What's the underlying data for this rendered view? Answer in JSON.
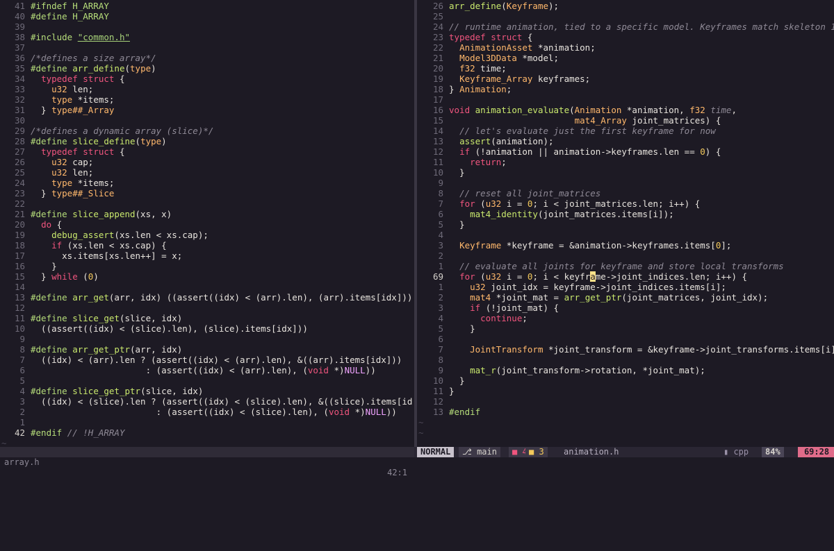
{
  "left": {
    "filename": "array.h",
    "position": "42:1",
    "lines": [
      {
        "n": "41",
        "h": [
          [
            "pp",
            "#ifndef H_ARRAY"
          ]
        ]
      },
      {
        "n": "40",
        "h": [
          [
            "pp",
            "#define H_ARRAY"
          ]
        ]
      },
      {
        "n": "39",
        "h": []
      },
      {
        "n": "38",
        "h": [
          [
            "pp",
            "#include "
          ],
          [
            "str",
            "\"common.h\""
          ]
        ]
      },
      {
        "n": "37",
        "h": []
      },
      {
        "n": "36",
        "h": [
          [
            "cm",
            "/*defines a size array*/"
          ]
        ]
      },
      {
        "n": "35",
        "h": [
          [
            "pp",
            "#define "
          ],
          [
            "fn",
            "arr_define"
          ],
          [
            "id",
            "("
          ],
          [
            "ty",
            "type"
          ],
          [
            "id",
            ")"
          ]
        ]
      },
      {
        "n": "34",
        "h": [
          [
            "id",
            "  "
          ],
          [
            "kw",
            "typedef struct "
          ],
          [
            "id",
            "{"
          ]
        ]
      },
      {
        "n": "33",
        "h": [
          [
            "id",
            "    "
          ],
          [
            "ty",
            "u32 "
          ],
          [
            "id",
            "len;"
          ]
        ]
      },
      {
        "n": "32",
        "h": [
          [
            "id",
            "    "
          ],
          [
            "ty",
            "type "
          ],
          [
            "id",
            "*items;"
          ]
        ]
      },
      {
        "n": "31",
        "h": [
          [
            "id",
            "  } "
          ],
          [
            "ty",
            "type##_Array"
          ]
        ]
      },
      {
        "n": "30",
        "h": []
      },
      {
        "n": "29",
        "h": [
          [
            "cm",
            "/*defines a dynamic array (slice)*/"
          ]
        ]
      },
      {
        "n": "28",
        "h": [
          [
            "pp",
            "#define "
          ],
          [
            "fn",
            "slice_define"
          ],
          [
            "id",
            "("
          ],
          [
            "ty",
            "type"
          ],
          [
            "id",
            ")"
          ]
        ]
      },
      {
        "n": "27",
        "h": [
          [
            "id",
            "  "
          ],
          [
            "kw",
            "typedef struct "
          ],
          [
            "id",
            "{"
          ]
        ]
      },
      {
        "n": "26",
        "h": [
          [
            "id",
            "    "
          ],
          [
            "ty",
            "u32 "
          ],
          [
            "id",
            "cap;"
          ]
        ]
      },
      {
        "n": "25",
        "h": [
          [
            "id",
            "    "
          ],
          [
            "ty",
            "u32 "
          ],
          [
            "id",
            "len;"
          ]
        ]
      },
      {
        "n": "24",
        "h": [
          [
            "id",
            "    "
          ],
          [
            "ty",
            "type "
          ],
          [
            "id",
            "*items;"
          ]
        ]
      },
      {
        "n": "23",
        "h": [
          [
            "id",
            "  } "
          ],
          [
            "ty",
            "type##_Slice"
          ]
        ]
      },
      {
        "n": "22",
        "h": []
      },
      {
        "n": "21",
        "h": [
          [
            "pp",
            "#define "
          ],
          [
            "fn",
            "slice_append"
          ],
          [
            "id",
            "(xs, x)"
          ]
        ]
      },
      {
        "n": "20",
        "h": [
          [
            "id",
            "  "
          ],
          [
            "kw",
            "do "
          ],
          [
            "id",
            "{"
          ]
        ]
      },
      {
        "n": "19",
        "h": [
          [
            "id",
            "    "
          ],
          [
            "fn",
            "debug_assert"
          ],
          [
            "id",
            "(xs.len < xs.cap);"
          ]
        ]
      },
      {
        "n": "18",
        "h": [
          [
            "id",
            "    "
          ],
          [
            "kw",
            "if "
          ],
          [
            "id",
            "(xs.len < xs.cap) {"
          ]
        ]
      },
      {
        "n": "17",
        "h": [
          [
            "id",
            "      xs.items[xs.len++] = x;"
          ]
        ]
      },
      {
        "n": "16",
        "h": [
          [
            "id",
            "    }"
          ]
        ]
      },
      {
        "n": "15",
        "h": [
          [
            "id",
            "  } "
          ],
          [
            "kw",
            "while "
          ],
          [
            "id",
            "("
          ],
          [
            "num",
            "0"
          ],
          [
            "id",
            ")"
          ]
        ]
      },
      {
        "n": "14",
        "h": []
      },
      {
        "n": "13",
        "h": [
          [
            "pp",
            "#define "
          ],
          [
            "fn",
            "arr_get"
          ],
          [
            "id",
            "(arr, idx) ((assert((idx) < (arr).len), (arr).items[idx]))"
          ]
        ]
      },
      {
        "n": "12",
        "h": []
      },
      {
        "n": "11",
        "h": [
          [
            "pp",
            "#define "
          ],
          [
            "fn",
            "slice_get"
          ],
          [
            "id",
            "(slice, idx)"
          ]
        ]
      },
      {
        "n": "10",
        "h": [
          [
            "id",
            "  ((assert((idx) < (slice).len), (slice).items[idx]))"
          ]
        ]
      },
      {
        "n": "9",
        "h": []
      },
      {
        "n": "8",
        "h": [
          [
            "pp",
            "#define "
          ],
          [
            "fn",
            "arr_get_ptr"
          ],
          [
            "id",
            "(arr, idx)"
          ]
        ]
      },
      {
        "n": "7",
        "h": [
          [
            "id",
            "  ((idx) < (arr).len ? (assert((idx) < (arr).len), &((arr).items[idx]))"
          ]
        ]
      },
      {
        "n": "6",
        "h": [
          [
            "id",
            "                      : (assert((idx) < (arr).len), ("
          ],
          [
            "kw",
            "void "
          ],
          [
            "id",
            "*)"
          ],
          [
            "mac",
            "NULL"
          ],
          [
            "id",
            "))"
          ]
        ]
      },
      {
        "n": "5",
        "h": []
      },
      {
        "n": "4",
        "h": [
          [
            "pp",
            "#define "
          ],
          [
            "fn",
            "slice_get_ptr"
          ],
          [
            "id",
            "(slice, idx)"
          ]
        ]
      },
      {
        "n": "3",
        "h": [
          [
            "id",
            "  ((idx) < (slice).len ? (assert((idx) < (slice).len), &((slice).items[id"
          ]
        ]
      },
      {
        "n": "2",
        "h": [
          [
            "id",
            "                        : (assert((idx) < (slice).len), ("
          ],
          [
            "kw",
            "void "
          ],
          [
            "id",
            "*)"
          ],
          [
            "mac",
            "NULL"
          ],
          [
            "id",
            "))"
          ]
        ]
      },
      {
        "n": "1",
        "h": []
      },
      {
        "n": "42",
        "cur": true,
        "h": [
          [
            "pp",
            "#endif "
          ],
          [
            "cm",
            "// !H_ARRAY"
          ]
        ]
      }
    ],
    "tildes": 1
  },
  "right": {
    "filename": "animation.h",
    "position": "69:28",
    "percent": "84%",
    "filetype": "cpp",
    "mode": "NORMAL",
    "branch": "main",
    "branch_icon": "git-branch-icon",
    "errors": "4",
    "warnings": "3",
    "lines": [
      {
        "n": "26",
        "h": [
          [
            "fn",
            "arr_define"
          ],
          [
            "id",
            "("
          ],
          [
            "ty",
            "Keyframe"
          ],
          [
            "id",
            ");"
          ]
        ]
      },
      {
        "n": "25",
        "h": []
      },
      {
        "n": "24",
        "h": [
          [
            "cm",
            "// runtime animation, tied to a specific model. Keyframes match skeleton 1"
          ]
        ]
      },
      {
        "n": "23",
        "h": [
          [
            "kw",
            "typedef struct "
          ],
          [
            "id",
            "{"
          ]
        ]
      },
      {
        "n": "22",
        "h": [
          [
            "id",
            "  "
          ],
          [
            "ty",
            "AnimationAsset "
          ],
          [
            "id",
            "*animation;"
          ]
        ]
      },
      {
        "n": "21",
        "h": [
          [
            "id",
            "  "
          ],
          [
            "ty",
            "Model3DData "
          ],
          [
            "id",
            "*model;"
          ]
        ]
      },
      {
        "n": "20",
        "h": [
          [
            "id",
            "  "
          ],
          [
            "ty",
            "f32 "
          ],
          [
            "id",
            "time;"
          ]
        ]
      },
      {
        "n": "19",
        "h": [
          [
            "id",
            "  "
          ],
          [
            "ty",
            "Keyframe_Array "
          ],
          [
            "id",
            "keyframes;"
          ]
        ]
      },
      {
        "n": "18",
        "h": [
          [
            "id",
            "} "
          ],
          [
            "ty",
            "Animation"
          ],
          [
            "id",
            ";"
          ]
        ]
      },
      {
        "n": "17",
        "h": []
      },
      {
        "n": "16",
        "h": [
          [
            "kw",
            "void "
          ],
          [
            "fn",
            "animation_evaluate"
          ],
          [
            "id",
            "("
          ],
          [
            "ty",
            "Animation "
          ],
          [
            "id",
            "*animation, "
          ],
          [
            "ty",
            "f32 "
          ],
          [
            "cm",
            "time"
          ],
          [
            "id",
            ","
          ]
        ]
      },
      {
        "n": "15",
        "h": [
          [
            "id",
            "                        "
          ],
          [
            "ty",
            "mat4_Array "
          ],
          [
            "id",
            "joint_matrices) {"
          ]
        ]
      },
      {
        "n": "14",
        "h": [
          [
            "id",
            "  "
          ],
          [
            "cm",
            "// let's evaluate just the first keyframe for now"
          ]
        ]
      },
      {
        "n": "13",
        "h": [
          [
            "id",
            "  "
          ],
          [
            "fn",
            "assert"
          ],
          [
            "id",
            "(animation);"
          ]
        ]
      },
      {
        "n": "12",
        "h": [
          [
            "id",
            "  "
          ],
          [
            "kw",
            "if "
          ],
          [
            "id",
            "(!animation || animation->keyframes.len == "
          ],
          [
            "num",
            "0"
          ],
          [
            "id",
            ") {"
          ]
        ]
      },
      {
        "n": "11",
        "h": [
          [
            "id",
            "    "
          ],
          [
            "kw",
            "return"
          ],
          [
            "id",
            ";"
          ]
        ]
      },
      {
        "n": "10",
        "h": [
          [
            "id",
            "  }"
          ]
        ]
      },
      {
        "n": "9",
        "h": []
      },
      {
        "n": "8",
        "h": [
          [
            "id",
            "  "
          ],
          [
            "cm",
            "// reset all joint_matrices"
          ]
        ]
      },
      {
        "n": "7",
        "h": [
          [
            "id",
            "  "
          ],
          [
            "kw",
            "for "
          ],
          [
            "id",
            "("
          ],
          [
            "ty",
            "u32 "
          ],
          [
            "id",
            "i = "
          ],
          [
            "num",
            "0"
          ],
          [
            "id",
            "; i < joint_matrices.len; i++) {"
          ]
        ]
      },
      {
        "n": "6",
        "h": [
          [
            "id",
            "    "
          ],
          [
            "fn",
            "mat4_identity"
          ],
          [
            "id",
            "(joint_matrices.items[i]);"
          ]
        ]
      },
      {
        "n": "5",
        "h": [
          [
            "id",
            "  }"
          ]
        ]
      },
      {
        "n": "4",
        "h": []
      },
      {
        "n": "3",
        "h": [
          [
            "id",
            "  "
          ],
          [
            "ty",
            "Keyframe "
          ],
          [
            "id",
            "*keyframe = &animation->keyframes.items["
          ],
          [
            "num",
            "0"
          ],
          [
            "id",
            "];"
          ]
        ]
      },
      {
        "n": "2",
        "h": []
      },
      {
        "n": "1",
        "h": [
          [
            "id",
            "  "
          ],
          [
            "cm",
            "// evaluate all joints for keyframe and store local transforms"
          ]
        ]
      },
      {
        "n": "69",
        "cur": true,
        "h": [
          [
            "id",
            "  "
          ],
          [
            "kw",
            "for "
          ],
          [
            "id",
            "("
          ],
          [
            "ty",
            "u32 "
          ],
          [
            "id",
            "i = "
          ],
          [
            "num",
            "0"
          ],
          [
            "id",
            "; i < keyfr"
          ],
          [
            "cursor",
            "a"
          ],
          [
            "id",
            "me->joint_indices.len; i++) {"
          ]
        ]
      },
      {
        "n": "1",
        "h": [
          [
            "id",
            "    "
          ],
          [
            "ty",
            "u32 "
          ],
          [
            "id",
            "joint_idx = keyframe->joint_indices.items[i];"
          ]
        ]
      },
      {
        "n": "2",
        "h": [
          [
            "id",
            "    "
          ],
          [
            "ty",
            "mat4 "
          ],
          [
            "id",
            "*joint_mat = "
          ],
          [
            "fn",
            "arr_get_ptr"
          ],
          [
            "id",
            "(joint_matrices, joint_idx);"
          ]
        ]
      },
      {
        "n": "3",
        "h": [
          [
            "id",
            "    "
          ],
          [
            "kw",
            "if "
          ],
          [
            "id",
            "(!joint_mat) {"
          ]
        ]
      },
      {
        "n": "4",
        "h": [
          [
            "id",
            "      "
          ],
          [
            "kw",
            "continue"
          ],
          [
            "id",
            ";"
          ]
        ]
      },
      {
        "n": "5",
        "h": [
          [
            "id",
            "    }"
          ]
        ]
      },
      {
        "n": "6",
        "h": []
      },
      {
        "n": "7",
        "h": [
          [
            "id",
            "    "
          ],
          [
            "ty",
            "JointTransform "
          ],
          [
            "id",
            "*joint_transform = &keyframe->joint_transforms.items[i]"
          ]
        ]
      },
      {
        "n": "8",
        "h": []
      },
      {
        "n": "9",
        "h": [
          [
            "id",
            "    "
          ],
          [
            "fn",
            "mat_r"
          ],
          [
            "id",
            "(joint_transform->rotation, *joint_mat);"
          ]
        ]
      },
      {
        "n": "10",
        "h": [
          [
            "id",
            "  }"
          ]
        ]
      },
      {
        "n": "11",
        "h": [
          [
            "id",
            "}"
          ]
        ]
      },
      {
        "n": "12",
        "h": []
      },
      {
        "n": "13",
        "h": [
          [
            "pp",
            "#endif"
          ]
        ]
      }
    ],
    "tildes": 2
  },
  "tilde_char": "~"
}
